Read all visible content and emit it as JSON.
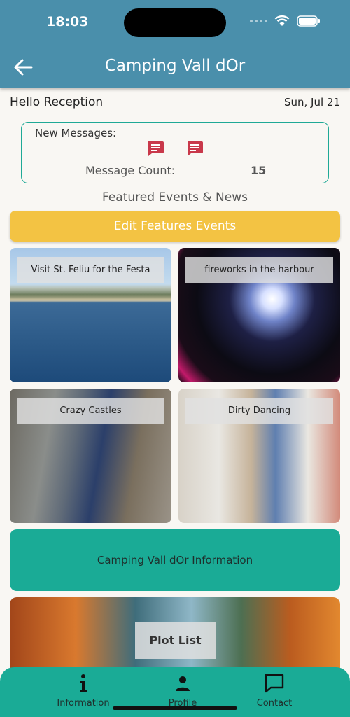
{
  "status_bar": {
    "time": "18:03"
  },
  "header": {
    "title": "Camping Vall dOr"
  },
  "greeting": "Hello Reception",
  "date": "Sun, Jul 21",
  "messages": {
    "label": "New Messages:",
    "count_label": "Message Count:",
    "count": "15"
  },
  "featured": {
    "section_title": "Featured Events & News",
    "edit_button": "Edit Features Events",
    "tiles": [
      {
        "caption": "Visit St. Feliu for the Festa"
      },
      {
        "caption": "fireworks in the harbour"
      },
      {
        "caption": "Crazy Castles"
      },
      {
        "caption": "Dirty Dancing"
      }
    ]
  },
  "info_button": "Camping Vall dOr Information",
  "plot_list": "Plot List",
  "nav": [
    {
      "label": "Information",
      "icon": "info-icon"
    },
    {
      "label": "Profile",
      "icon": "person-icon"
    },
    {
      "label": "Contact",
      "icon": "chat-bubble-icon"
    }
  ],
  "colors": {
    "appbar": "#4a8fab",
    "teal": "#1aab96",
    "yellow_button": "#f3c343",
    "message_icon": "#c9384a"
  }
}
